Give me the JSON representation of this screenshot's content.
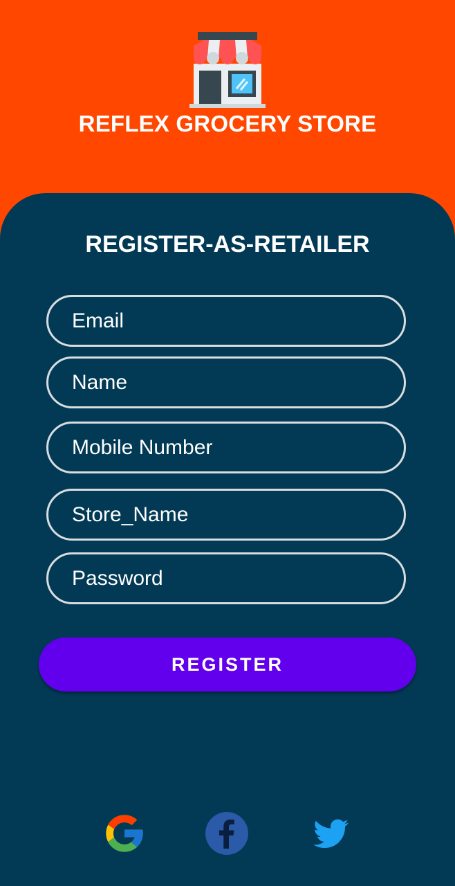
{
  "header": {
    "logo_icon": "grocery-store-icon",
    "title": "REFLEX GROCERY STORE",
    "background_color": "#ff4700"
  },
  "form": {
    "title": "REGISTER-AS-RETAILER",
    "background_color": "#023a55",
    "fields": [
      {
        "placeholder": "Email"
      },
      {
        "placeholder": "Name"
      },
      {
        "placeholder": "Mobile Number"
      },
      {
        "placeholder": "Store_Name"
      },
      {
        "placeholder": "Password"
      }
    ],
    "register_label": "REGISTER",
    "register_color": "#6200ee"
  },
  "social": {
    "items": [
      {
        "icon": "google-icon"
      },
      {
        "icon": "facebook-icon"
      },
      {
        "icon": "twitter-icon"
      }
    ]
  }
}
